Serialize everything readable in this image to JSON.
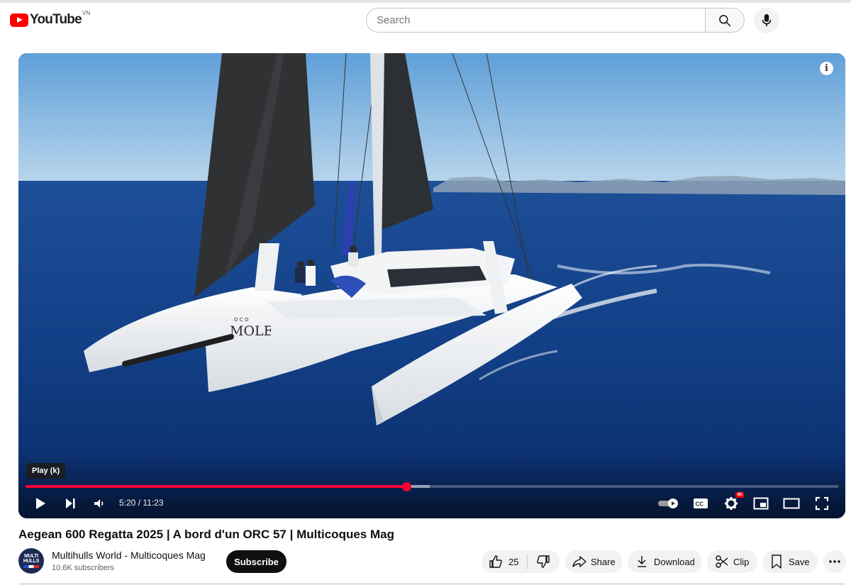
{
  "header": {
    "logo_text": "YouTube",
    "country_code": "VN",
    "search_placeholder": "Search"
  },
  "player": {
    "tooltip": "Play (k)",
    "time_current": "5:20",
    "time_total": "11:23",
    "time_display": "5:20 / 11:23",
    "progress_fraction": 0.4688,
    "buffered_fraction": 0.4975,
    "hd_badge": "4K",
    "boat_name_top": "O C O",
    "boat_name": "MOLE",
    "accent_color": "#ff0033"
  },
  "video": {
    "title": "Aegean 600 Regatta 2025 | A bord d'un ORC 57 | Multicoques Mag"
  },
  "channel": {
    "name": "Multihulls World - Multicoques Mag",
    "subscribers": "10.6K subscribers",
    "avatar_text_1": "MULTI",
    "avatar_text_2": "HULLS",
    "subscribe_label": "Subscribe"
  },
  "actions": {
    "likes": "25",
    "share": "Share",
    "download": "Download",
    "clip": "Clip",
    "save": "Save"
  },
  "icons": [
    "youtube-logo-icon",
    "search-icon",
    "mic-icon",
    "info-icon",
    "play-icon",
    "next-icon",
    "volume-icon",
    "autoplay-icon",
    "captions-icon",
    "settings-icon",
    "miniplayer-icon",
    "theater-icon",
    "fullscreen-icon",
    "like-icon",
    "dislike-icon",
    "share-icon",
    "download-icon",
    "clip-icon",
    "save-icon",
    "more-icon"
  ]
}
